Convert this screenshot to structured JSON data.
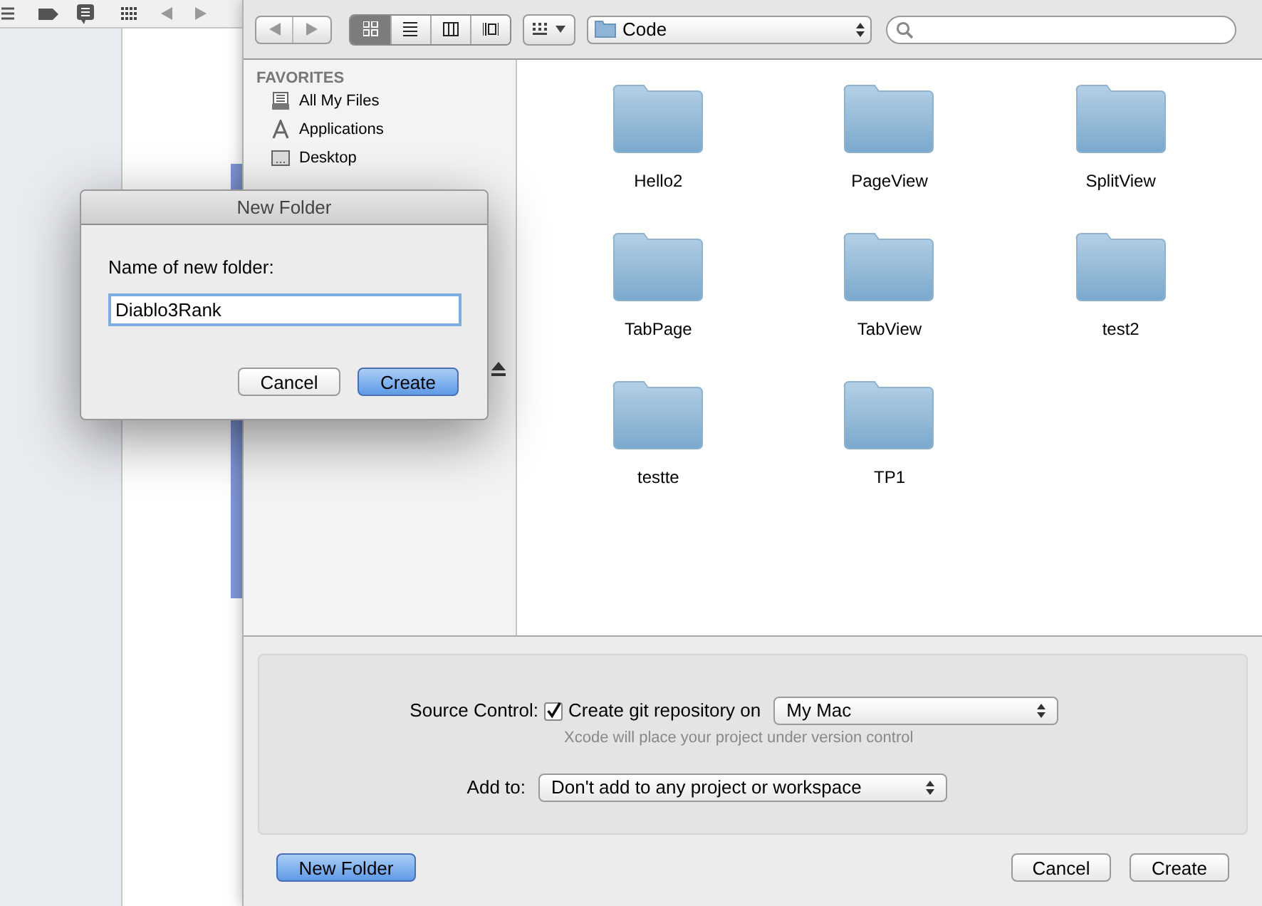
{
  "toolbar": {
    "view_modes": [
      {
        "selected": true
      },
      {
        "selected": false
      },
      {
        "selected": false
      },
      {
        "selected": false
      }
    ],
    "location": "Code"
  },
  "sidebar": {
    "heading": "FAVORITES",
    "items": [
      {
        "label": "All My Files",
        "kind": "files"
      },
      {
        "label": "Applications",
        "kind": "apps"
      },
      {
        "label": "Desktop",
        "kind": "desktop"
      }
    ]
  },
  "folders": [
    {
      "name": "Hello2"
    },
    {
      "name": "PageView"
    },
    {
      "name": "SplitView"
    },
    {
      "name": "TabPage"
    },
    {
      "name": "TabView"
    },
    {
      "name": "test2"
    },
    {
      "name": "testte"
    },
    {
      "name": "TP1"
    }
  ],
  "options": {
    "source_control_label": "Source Control:",
    "git_checked": true,
    "git_label": "Create git repository on",
    "git_target": "My Mac",
    "git_hint": "Xcode will place your project under version control",
    "add_to_label": "Add to:",
    "add_to_value": "Don't add to any project or workspace"
  },
  "footer": {
    "new_folder": "New Folder",
    "cancel": "Cancel",
    "create": "Create"
  },
  "dialog": {
    "title": "New Folder",
    "label": "Name of new folder:",
    "value": "Diablo3Rank",
    "cancel": "Cancel",
    "create": "Create"
  }
}
